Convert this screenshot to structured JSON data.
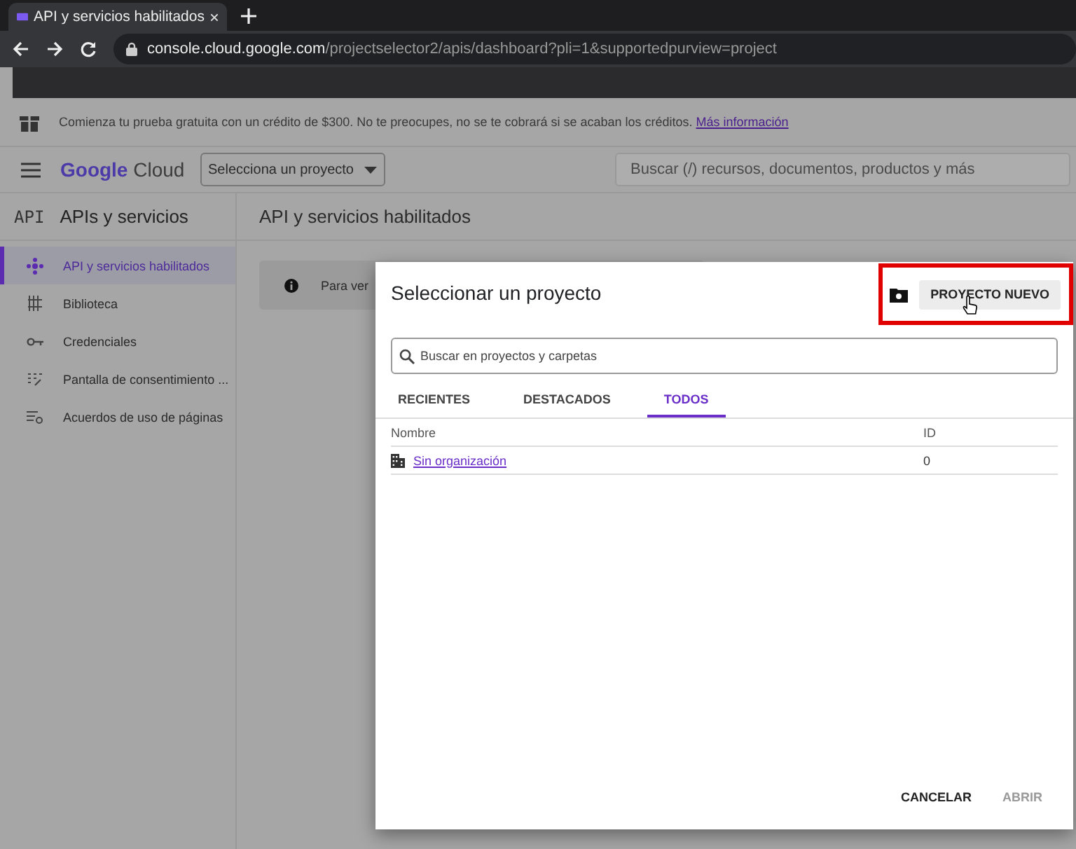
{
  "browser": {
    "tab_title": "API y servicios habilitados",
    "url_host": "console.cloud.google.com",
    "url_path": "/projectselector2/apis/dashboard?pli=1&supportedpurview=project"
  },
  "banner": {
    "text": "Comienza tu prueba gratuita con un crédito de $300. No te preocupes, no se te cobrará si se acaban los créditos.",
    "link": "Más información"
  },
  "header": {
    "logo_google": "Google",
    "logo_cloud": "Cloud",
    "project_selector": "Selecciona un proyecto",
    "search": {
      "placeholder": "Buscar (/) recursos, documentos, productos y más"
    }
  },
  "sidebar": {
    "badge": "API",
    "title": "APIs y servicios",
    "items": [
      {
        "label": "API y servicios habilitados",
        "kind": "apis",
        "selected": true
      },
      {
        "label": "Biblioteca",
        "kind": "library",
        "selected": false
      },
      {
        "label": "Credenciales",
        "kind": "key",
        "selected": false
      },
      {
        "label": "Pantalla de consentimiento ...",
        "kind": "consent",
        "selected": false
      },
      {
        "label": "Acuerdos de uso de páginas",
        "kind": "settings",
        "selected": false
      }
    ]
  },
  "content": {
    "title": "API y servicios habilitados",
    "notice": "Para ver"
  },
  "dialog": {
    "title": "Seleccionar un proyecto",
    "new_project": {
      "label": "PROYECTO NUEVO",
      "highlighted": true
    },
    "search": {
      "placeholder": "Buscar en proyectos y carpetas"
    },
    "tabs": [
      {
        "label": "RECIENTES",
        "selected": false
      },
      {
        "label": "DESTACADOS",
        "selected": false
      },
      {
        "label": "TODOS",
        "selected": true
      }
    ],
    "columns": [
      "Nombre",
      "ID"
    ],
    "rows": [
      {
        "name": "Sin organización",
        "id": "0"
      }
    ],
    "buttons": [
      {
        "label": "CANCELAR",
        "disabled": false
      },
      {
        "label": "ABRIR",
        "disabled": true
      }
    ]
  }
}
